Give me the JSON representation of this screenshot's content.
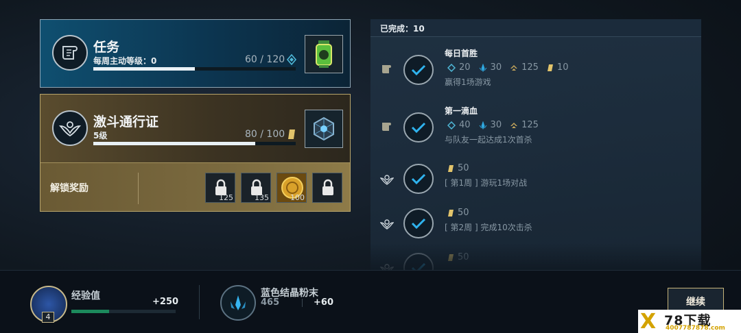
{
  "mission": {
    "title": "任务",
    "subtitle": "每周主动等级：0",
    "progress_text": "60 / 120",
    "progress_fraction": 0.5
  },
  "pass": {
    "title": "激斗通行证",
    "level": "5级",
    "progress_text": "80 / 100",
    "progress_fraction": 0.8
  },
  "unlock_rewards": {
    "label": "解锁奖励",
    "items": [
      {
        "icon": "locked-chest-icon",
        "count": "125"
      },
      {
        "icon": "locked-chest-icon",
        "count": "135"
      },
      {
        "icon": "gold-coin-icon",
        "count": "100"
      },
      {
        "icon": "locked-chest-icon",
        "count": ""
      }
    ]
  },
  "completed": {
    "header": "已完成：10",
    "quests": [
      {
        "type": "mission",
        "name": "每日首胜",
        "rewards": [
          {
            "icon": "pass-xp-icon",
            "value": "20"
          },
          {
            "icon": "blue-essence-icon",
            "value": "30"
          },
          {
            "icon": "rank-icon",
            "value": "125"
          },
          {
            "icon": "token-icon",
            "value": "10"
          }
        ],
        "desc": "赢得1场游戏"
      },
      {
        "type": "mission",
        "name": "第一滴血",
        "rewards": [
          {
            "icon": "pass-xp-icon",
            "value": "40"
          },
          {
            "icon": "blue-essence-icon",
            "value": "30"
          },
          {
            "icon": "rank-icon",
            "value": "125"
          }
        ],
        "desc": "与队友一起达成1次首杀"
      },
      {
        "type": "pass",
        "name": "",
        "rewards": [
          {
            "icon": "token-icon",
            "value": "50"
          }
        ],
        "desc": "[ 第1周 ] 游玩1场对战"
      },
      {
        "type": "pass",
        "name": "",
        "rewards": [
          {
            "icon": "token-icon",
            "value": "50"
          }
        ],
        "desc": "[ 第2周 ] 完成10次击杀"
      },
      {
        "type": "pass",
        "name": "",
        "rewards": [
          {
            "icon": "token-icon",
            "value": "50"
          }
        ],
        "desc": ""
      }
    ]
  },
  "bottom": {
    "exp_label": "经验值",
    "exp_gain": "+250",
    "exp_fraction": 0.36,
    "level": "4",
    "crystal_label": "蓝色结晶粉末",
    "crystal_total": "465",
    "crystal_gain": "+60",
    "continue_label": "继续"
  },
  "watermark": {
    "brand": "78下载",
    "site": "4007787878.com"
  },
  "colors": {
    "accent_gold": "#c7b57b",
    "check_blue": "#2fb3ee",
    "mission_blue": "#0f4f70"
  }
}
